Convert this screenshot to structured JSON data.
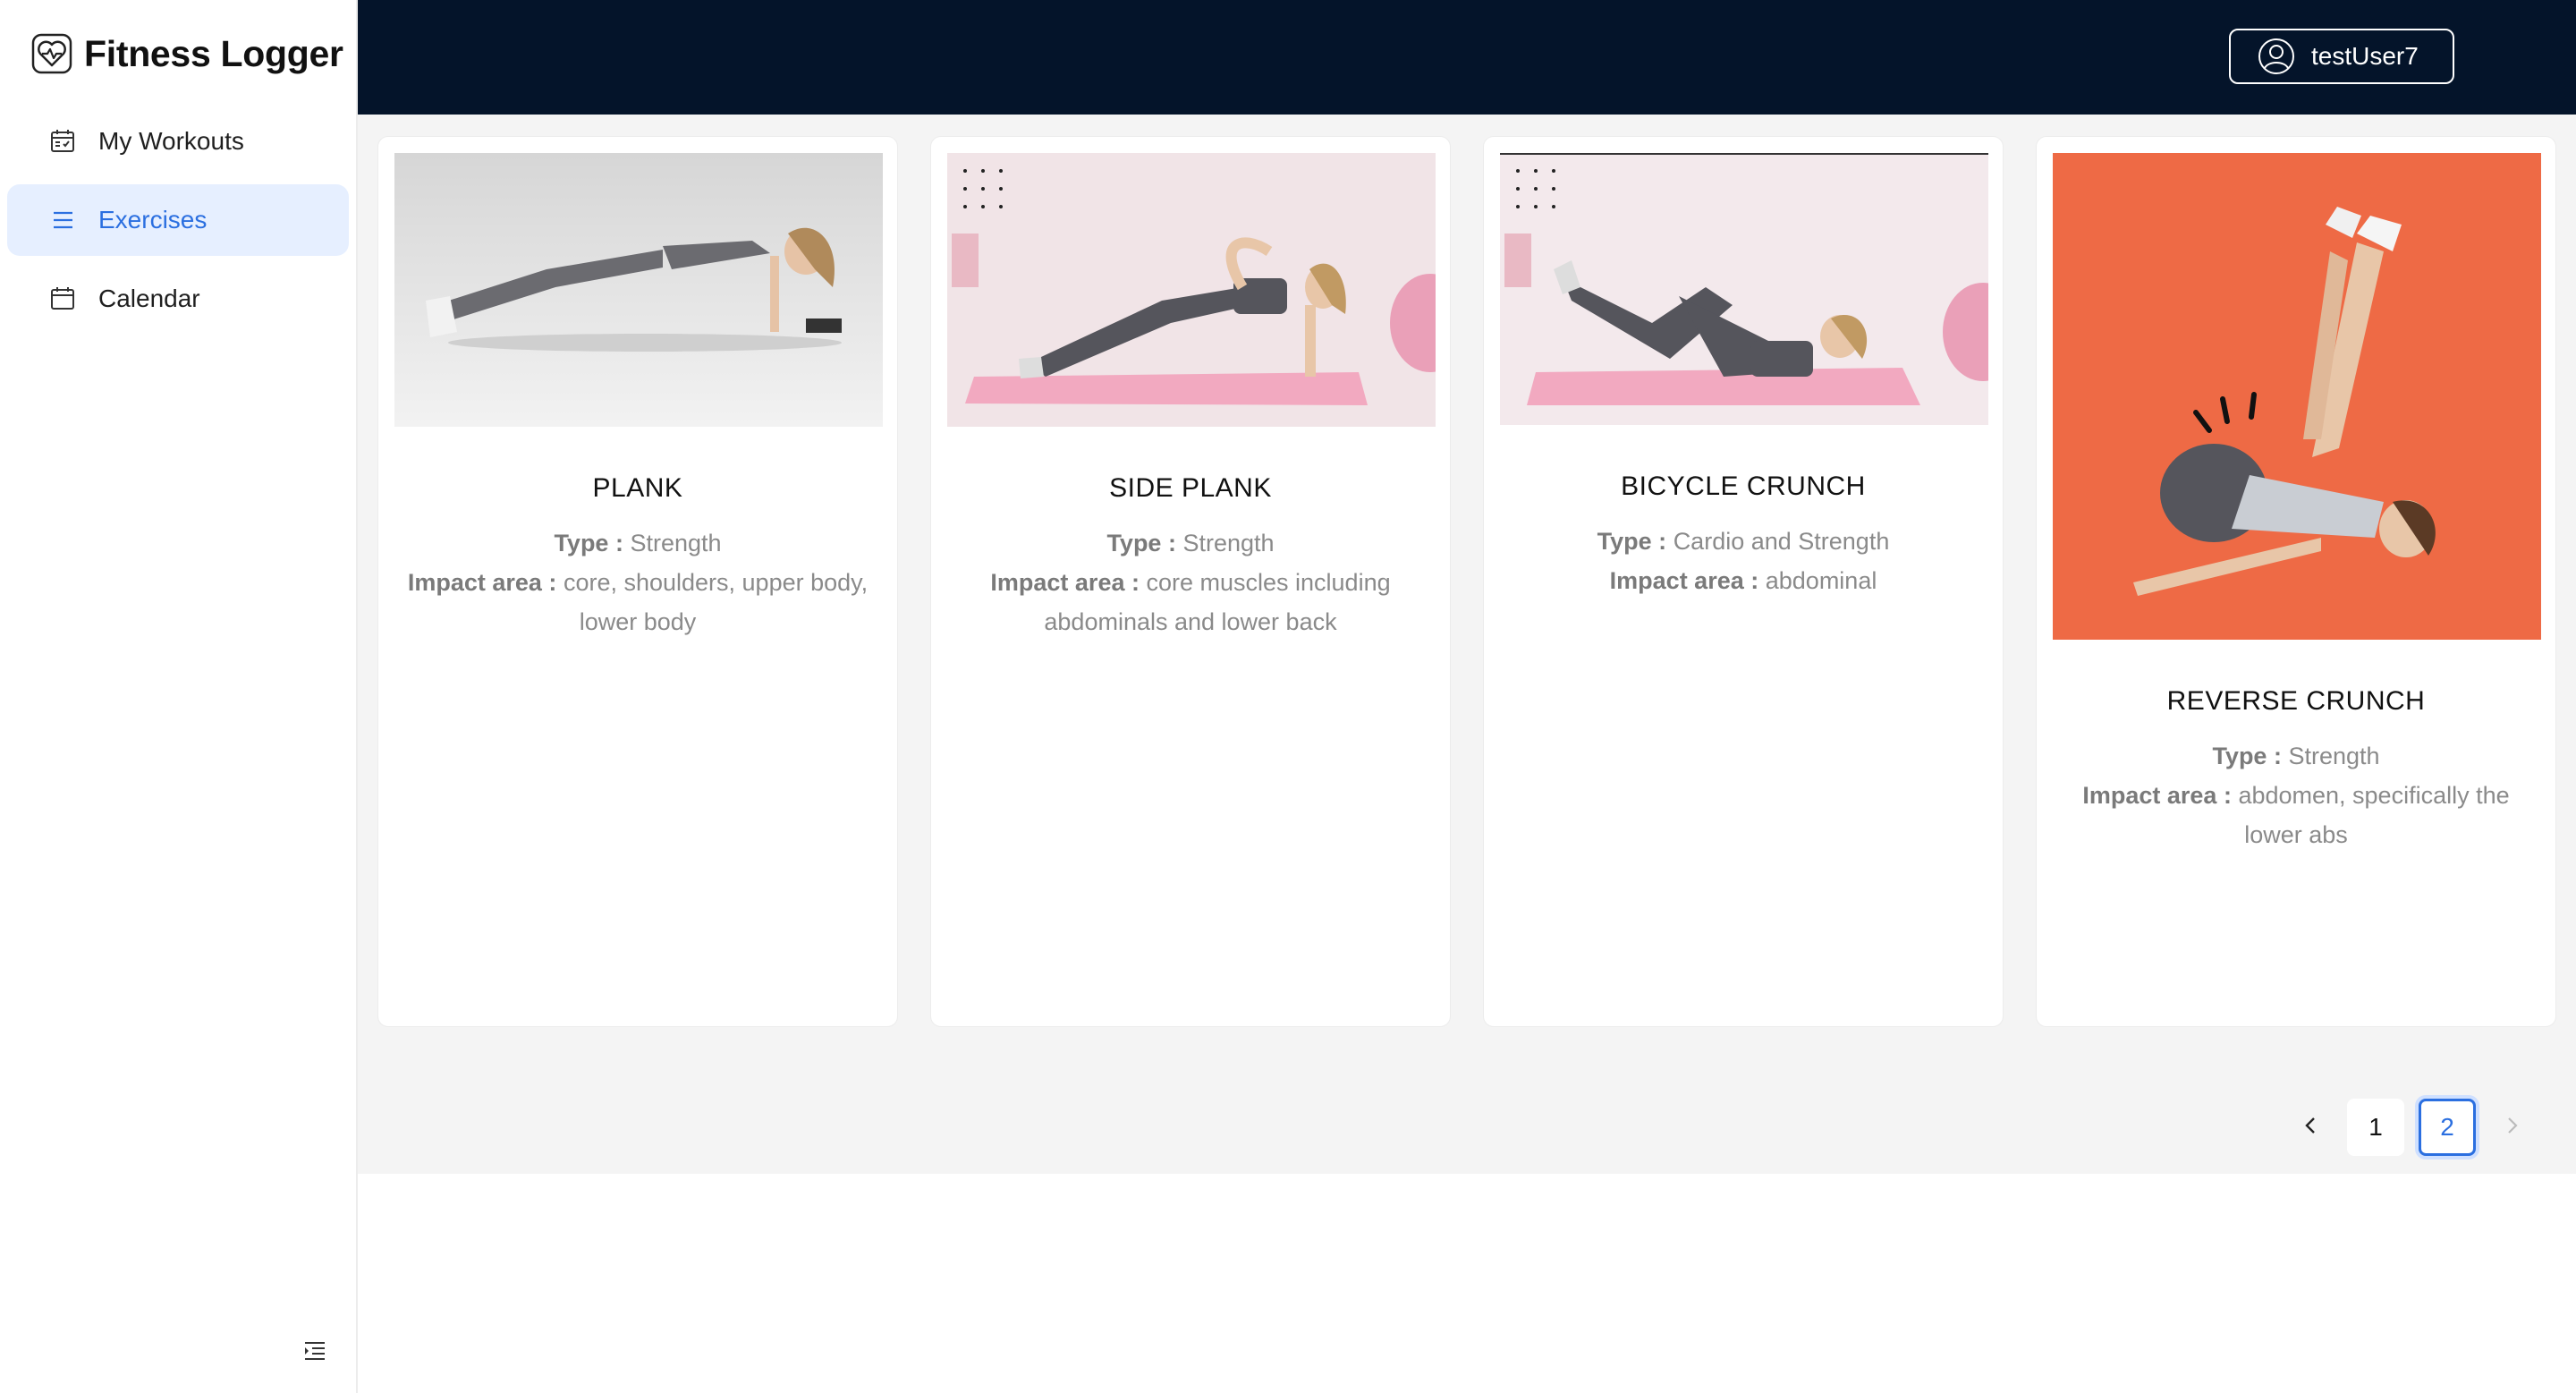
{
  "app": {
    "title": "Fitness Logger"
  },
  "sidebar": {
    "items": [
      {
        "label": "My Workouts",
        "icon": "calendar-check-icon"
      },
      {
        "label": "Exercises",
        "icon": "list-icon",
        "active": true
      },
      {
        "label": "Calendar",
        "icon": "calendar-icon"
      }
    ]
  },
  "header": {
    "user": "testUser7"
  },
  "exercises": [
    {
      "name": "PLANK",
      "type_label": "Type :",
      "type": "Strength",
      "impact_label": "Impact area :",
      "impact": "core, shoulders, upper body, lower body"
    },
    {
      "name": "SIDE PLANK",
      "type_label": "Type :",
      "type": "Strength",
      "impact_label": "Impact area :",
      "impact": "core muscles including abdominals and lower back"
    },
    {
      "name": "BICYCLE CRUNCH",
      "type_label": "Type :",
      "type": "Cardio and Strength",
      "impact_label": "Impact area :",
      "impact": "abdominal"
    },
    {
      "name": "REVERSE CRUNCH",
      "type_label": "Type :",
      "type": "Strength",
      "impact_label": "Impact area :",
      "impact": "abdomen, specifically the lower abs"
    }
  ],
  "pagination": {
    "pages": [
      "1",
      "2"
    ],
    "current": "2"
  },
  "colors": {
    "header_bg": "#04142a",
    "accent": "#2b6fe0",
    "active_nav_bg": "#e6efff",
    "reverse_crunch_bg": "#ee6a45"
  }
}
